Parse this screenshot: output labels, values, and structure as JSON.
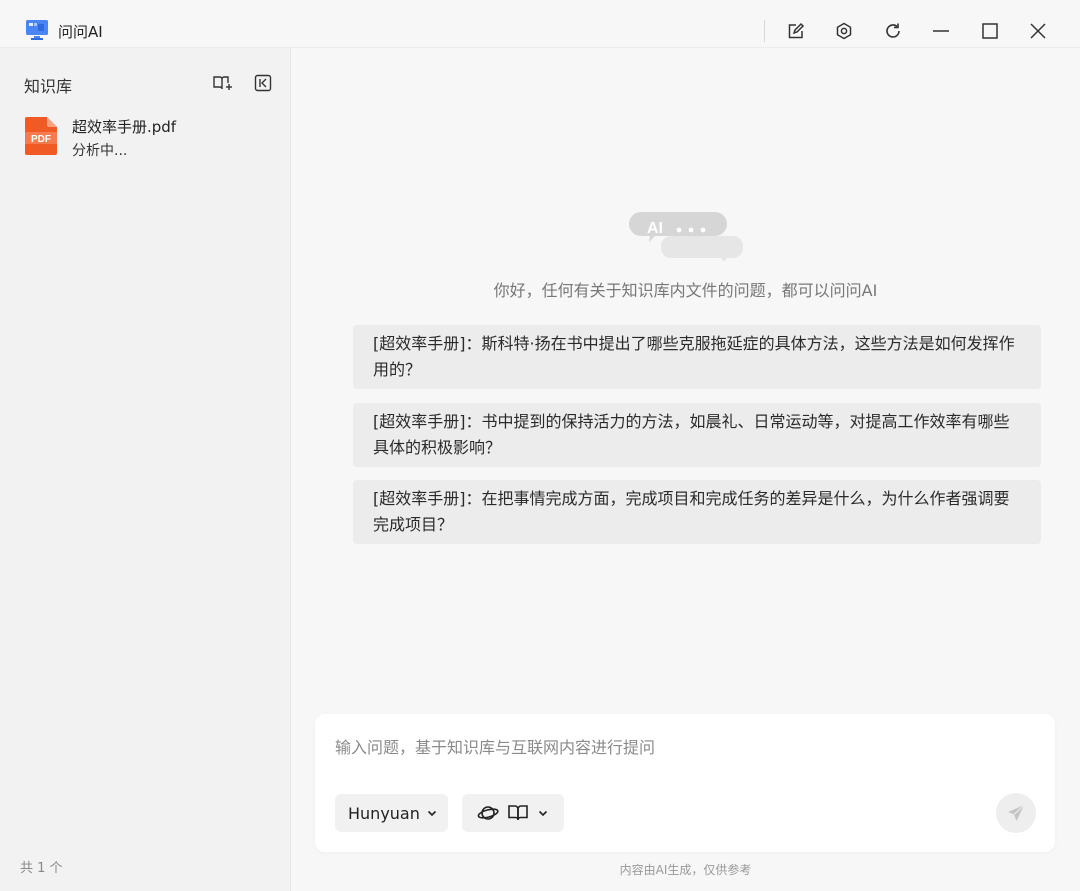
{
  "window": {
    "title": "问问AI",
    "buttons": [
      "new-chat-icon",
      "gear-icon",
      "refresh-icon",
      "minimize-icon",
      "maximize-icon",
      "close-icon"
    ]
  },
  "sidebar": {
    "title": "知识库",
    "files": [
      {
        "name": "超效率手册.pdf",
        "status": "分析中...",
        "icon": "pdf-icon",
        "badge": "PDF"
      }
    ],
    "count": "共 1 个"
  },
  "main": {
    "logo_text": "AI",
    "greeting": "你好，任何有关于知识库内文件的问题，都可以问问AI",
    "suggestions": [
      "[超效率手册]：斯科特·扬在书中提出了哪些克服拖延症的具体方法，这些方法是如何发挥作用的？",
      "[超效率手册]：书中提到的保持活力的方法，如晨礼、日常运动等，对提高工作效率有哪些具体的积极影响？",
      "[超效率手册]：在把事情完成方面，完成项目和完成任务的差异是什么，为什么作者强调要完成项目？"
    ],
    "composer": {
      "placeholder": "输入问题，基于知识库与互联网内容进行提问",
      "model": "Hunyuan"
    },
    "disclaimer": "内容由AI生成，仅供参考"
  },
  "colors": {
    "pdf": "#f05a24",
    "accent_blue": "#3f7cf0"
  }
}
